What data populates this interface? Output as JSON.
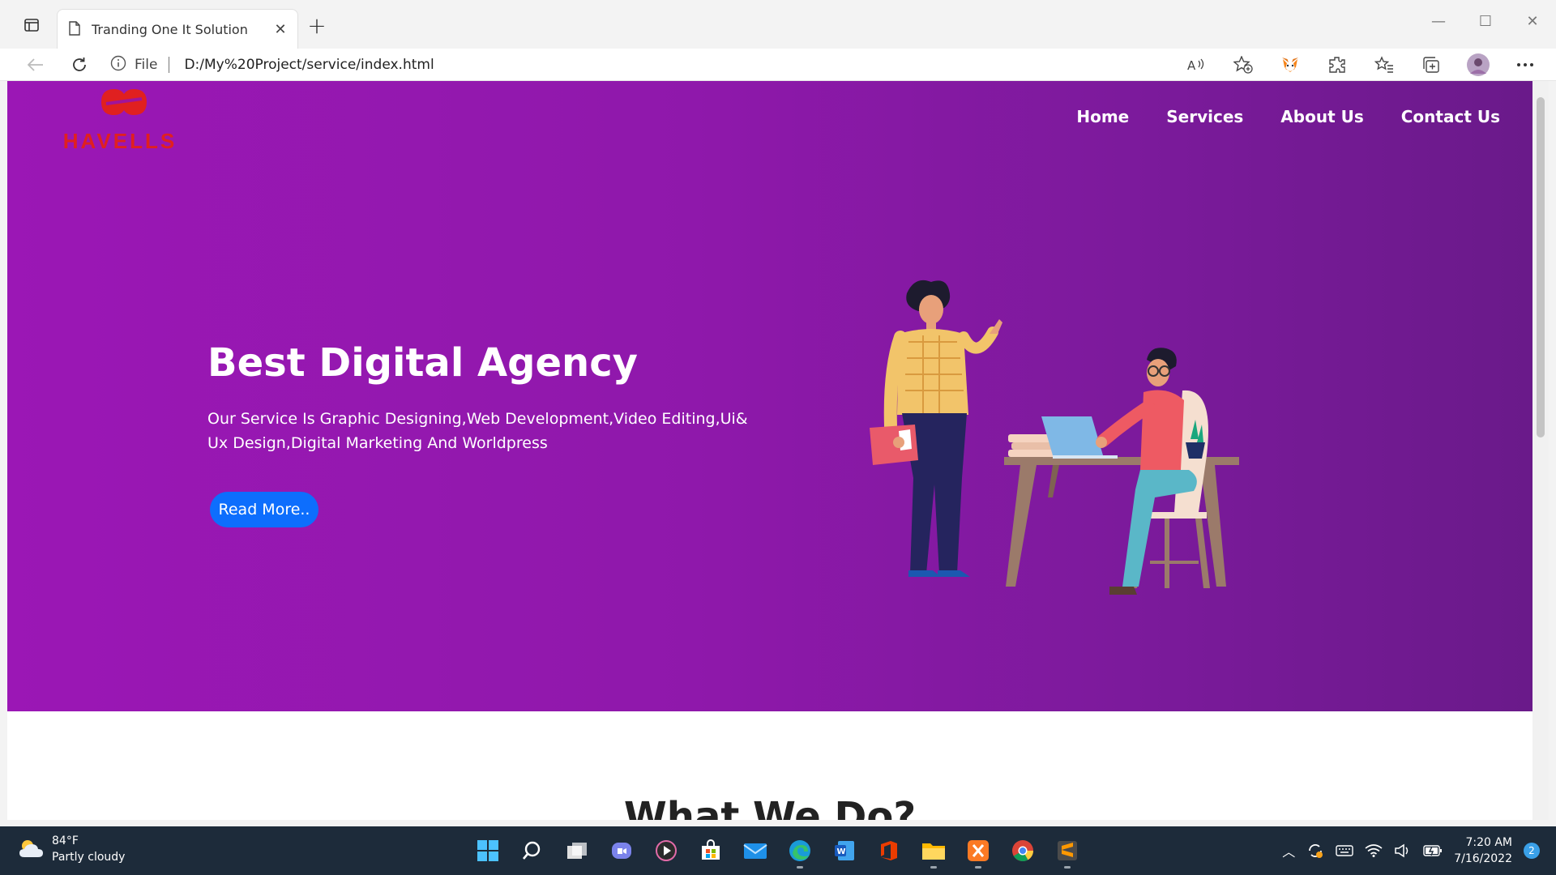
{
  "browser": {
    "tab_title": "Tranding One It Solution",
    "address_prefix": "File",
    "url": "D:/My%20Project/service/index.html",
    "icons": [
      "tab-actions-icon",
      "page-icon",
      "close-icon",
      "new-tab-icon",
      "back-icon",
      "refresh-icon",
      "info-icon",
      "read-aloud-icon",
      "add-favorite-icon",
      "metamask-extension-icon",
      "extensions-icon",
      "favorites-icon",
      "collections-icon",
      "profile-avatar",
      "more-icon"
    ]
  },
  "site": {
    "brand": "HAVELLS",
    "nav": [
      "Home",
      "Services",
      "About Us",
      "Contact Us"
    ],
    "hero_title": "Best Digital Agency",
    "hero_text": "Our Service Is Graphic Designing,Web Development,Video Editing,Ui& Ux Design,Digital Marketing And Worldpress",
    "cta_label": "Read More..",
    "section_title": "What We Do?"
  },
  "taskbar": {
    "weather_temp": "84°F",
    "weather_desc": "Partly cloudy",
    "time": "7:20 AM",
    "date": "7/16/2022",
    "notification_count": "2"
  },
  "colors": {
    "hero_start": "#9b17b5",
    "hero_end": "#6a1a8a",
    "cta": "#0d6efd",
    "brand_red": "#e02020",
    "taskbar": "#1d2b3a"
  }
}
